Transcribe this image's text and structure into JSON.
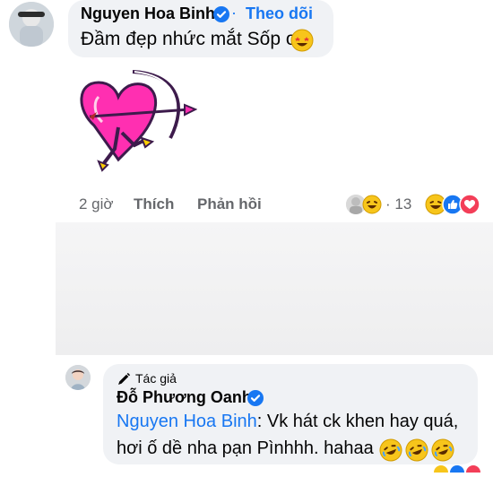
{
  "comment": {
    "author": "Nguyen Hoa Binh",
    "dot": "·",
    "follow": "Theo dõi",
    "text": "Đầm đẹp nhức mắt Sốp ơi",
    "meta": {
      "time": "2 giờ",
      "like": "Thích",
      "reply": "Phản hồi"
    },
    "reactions": {
      "count_text": "· 13",
      "icons": [
        "user-avatar-icon",
        "laugh-react-icon",
        "laugh-react-icon",
        "like-react-icon",
        "love-react-icon"
      ]
    }
  },
  "reply": {
    "role": "Tác giả",
    "author": "Đỗ Phương Oanh",
    "mention": "Nguyen Hoa Binh",
    "text_line1_after_mention": ": Vk hát ck khen hay quá,",
    "text_line2": "hơi ố dề nha pạn Pìnhhh. hahaa",
    "emojis": [
      "rofl-emoji",
      "rofl-emoji",
      "rofl-emoji"
    ]
  },
  "colors": {
    "bubble": "#f0f2f5",
    "link_blue": "#1877f2",
    "meta_gray": "#65676b",
    "heart_pink": "#ff2fb1"
  }
}
